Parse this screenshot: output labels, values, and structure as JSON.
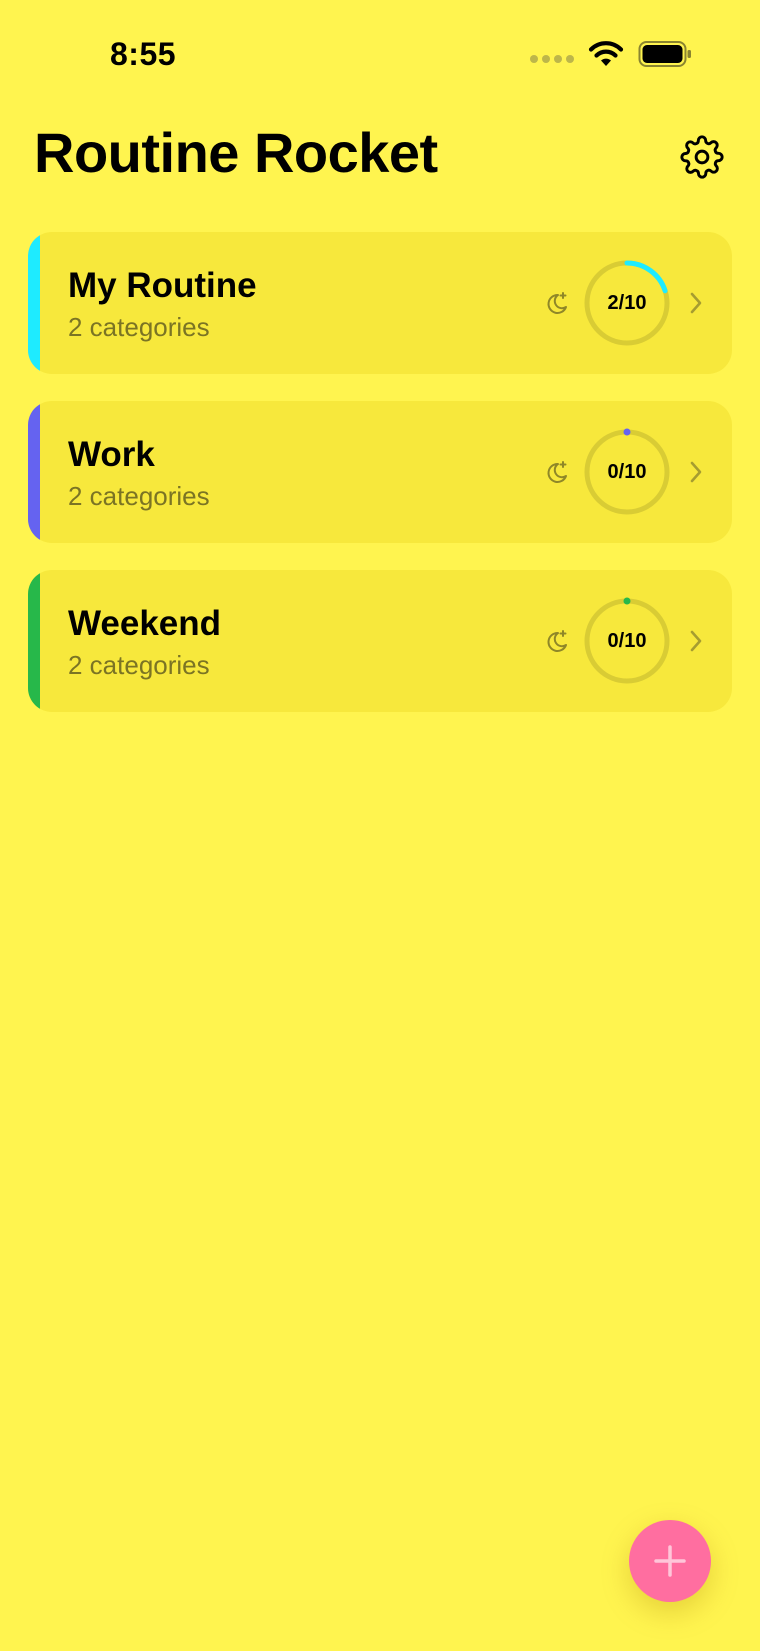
{
  "status_bar": {
    "time": "8:55"
  },
  "header": {
    "title": "Routine Rocket"
  },
  "routines": [
    {
      "name": "My Routine",
      "subtitle": "2 categories",
      "progress_label": "2/10",
      "completed": 2,
      "total": 10,
      "accent": "#1EEBFF"
    },
    {
      "name": "Work",
      "subtitle": "2 categories",
      "progress_label": "0/10",
      "completed": 0,
      "total": 10,
      "accent": "#6563F0"
    },
    {
      "name": "Weekend",
      "subtitle": "2 categories",
      "progress_label": "0/10",
      "completed": 0,
      "total": 10,
      "accent": "#27B84A"
    }
  ],
  "icons": {
    "settings": "gear-icon",
    "routine_mode": "moon-stars-icon",
    "open": "chevron-right-icon",
    "add": "plus-icon",
    "wifi": "wifi-icon",
    "battery": "battery-icon",
    "signal": "cellular-signal-icon"
  },
  "colors": {
    "background": "#FFF44F",
    "card": "#F7E83C",
    "ring_track": "#D9CC34",
    "fab": "#FF6EA0"
  }
}
